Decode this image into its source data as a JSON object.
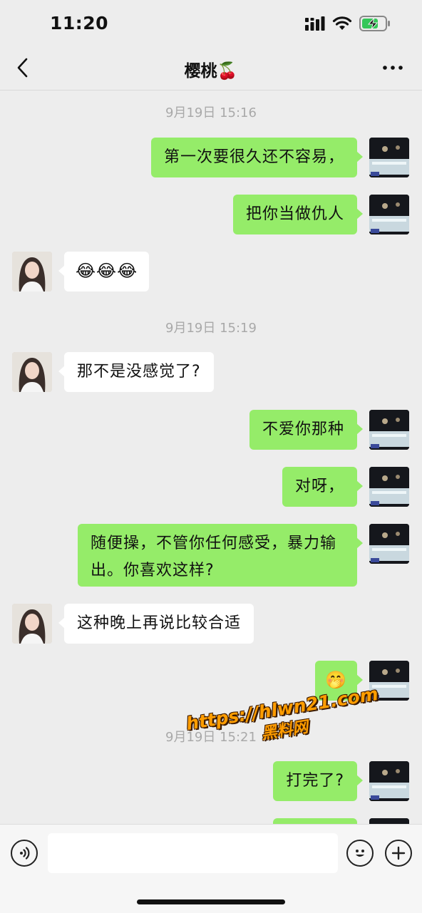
{
  "status_bar": {
    "time": "11:20"
  },
  "nav": {
    "title": "樱桃🍒"
  },
  "timestamps": [
    "9月19日 15:16",
    "9月19日 15:19",
    "9月19日 15:21"
  ],
  "messages": [
    {
      "sender": "me",
      "text": "第一次要很久还不容易，"
    },
    {
      "sender": "me",
      "text": "把你当做仇人"
    },
    {
      "sender": "other",
      "text": "😂😂😂"
    },
    {
      "sender": "other",
      "text": "那不是没感觉了?"
    },
    {
      "sender": "me",
      "text": "不爱你那种"
    },
    {
      "sender": "me",
      "text": "对呀，"
    },
    {
      "sender": "me",
      "text": "随便操，不管你任何感受，暴力输\n出。你喜欢这样?"
    },
    {
      "sender": "other",
      "text": "这种晚上再说比较合适"
    },
    {
      "sender": "me",
      "text": "🤭"
    },
    {
      "sender": "me",
      "text": "打完了?"
    },
    {
      "sender": "me",
      "text": ""
    }
  ],
  "watermark": {
    "url": "https://hlwn21.com",
    "name": "黑料网"
  },
  "input_bar": {
    "value": ""
  },
  "colors": {
    "me_bubble": "#95ec69",
    "other_bubble": "#ffffff",
    "background": "#ededed",
    "watermark": "#ff9d00"
  }
}
